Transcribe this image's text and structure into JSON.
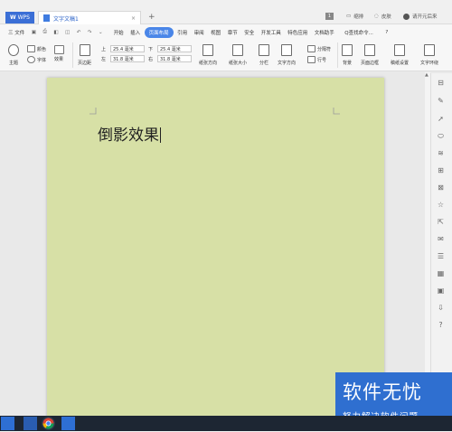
{
  "titlebar": {
    "app_label": "WPS",
    "doc_tab_label": "文字文稿1",
    "close_glyph": "×",
    "new_tab_glyph": "+",
    "right_items": [
      "缩排",
      "皮肤",
      "请开元后来"
    ],
    "badge_count": "1"
  },
  "menubar": {
    "file_label": "三 文件",
    "tabs": [
      "开始",
      "插入",
      "页面布局",
      "引用",
      "审阅",
      "视图",
      "章节",
      "安全",
      "开发工具",
      "特色应用",
      "文档助手"
    ],
    "active_tab": "页面布局",
    "search_label": "Q查找命令...",
    "help_glyph": "?"
  },
  "ribbon": {
    "theme_label": "主题",
    "color_label": "颜色",
    "font_label": "字体",
    "effect_label": "效果",
    "margins_label": "页边距",
    "margin_top_label": "上",
    "margin_top_value": "25.4 毫米",
    "margin_bottom_label": "下",
    "margin_bottom_value": "25.4 毫米",
    "margin_left_label": "左",
    "margin_left_value": "31.8 毫米",
    "margin_right_label": "右",
    "margin_right_value": "31.8 毫米",
    "orientation_label": "纸张方向",
    "size_label": "纸张大小",
    "columns_label": "分栏",
    "text_direction_label": "文字方向",
    "breaks_label": "分隔符",
    "line_numbers_label": "行号",
    "background_label": "背景",
    "page_border_label": "页面边框",
    "paper_setup_label": "稿纸设置",
    "text_wrap_label": "文字环绕"
  },
  "document": {
    "text": "倒影效果",
    "page_color": "#d7e0a6"
  },
  "watermark": {
    "title": "软件无忧",
    "subtitle": "努力解决软件问题"
  },
  "colors": {
    "accent": "#4a86e8",
    "watermark_bg": "#2f6fd0",
    "taskbar": "#1d2633"
  }
}
